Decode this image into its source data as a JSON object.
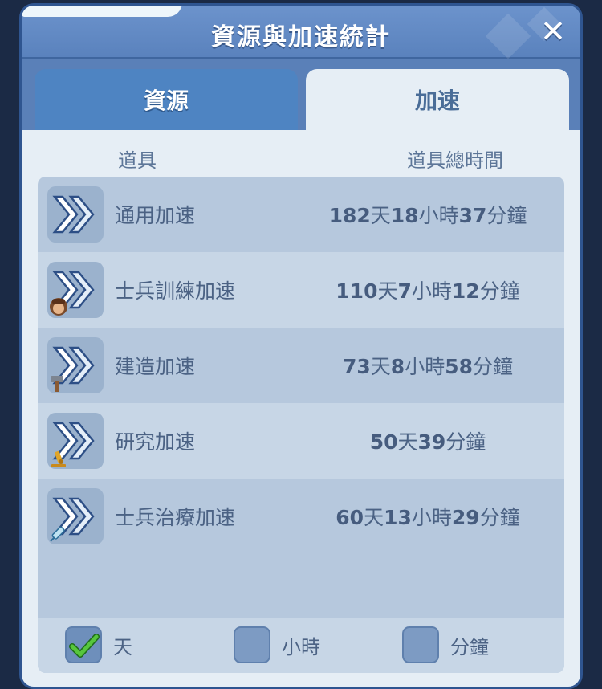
{
  "header": {
    "title": "資源與加速統計",
    "close_icon": "close-icon"
  },
  "tabs": [
    {
      "label": "資源",
      "active": false
    },
    {
      "label": "加速",
      "active": true
    }
  ],
  "columns": {
    "item": "道具",
    "total_time": "道具總時間"
  },
  "items": [
    {
      "name": "通用加速",
      "icon": "speedup-arrows-icon",
      "badge": "",
      "days": "182",
      "hours": "18",
      "minutes": "37"
    },
    {
      "name": "士兵訓練加速",
      "icon": "speedup-arrows-icon",
      "badge": "soldier-head-icon",
      "days": "110",
      "hours": "7",
      "minutes": "12"
    },
    {
      "name": "建造加速",
      "icon": "speedup-arrows-icon",
      "badge": "hammer-icon",
      "days": "73",
      "hours": "8",
      "minutes": "58"
    },
    {
      "name": "研究加速",
      "icon": "speedup-arrows-icon",
      "badge": "microscope-icon",
      "days": "50",
      "hours": "",
      "minutes": "39"
    },
    {
      "name": "士兵治療加速",
      "icon": "speedup-arrows-icon",
      "badge": "syringe-icon",
      "days": "60",
      "hours": "13",
      "minutes": "29"
    }
  ],
  "units": {
    "day": "天",
    "hour": "小時",
    "minute": "分鐘"
  },
  "footer": {
    "options": [
      {
        "label": "天",
        "checked": true
      },
      {
        "label": "小時",
        "checked": false
      },
      {
        "label": "分鐘",
        "checked": false
      }
    ]
  },
  "colors": {
    "panel": "#5a80b8",
    "active_tab": "#e6eef5",
    "inactive_tab": "#4e84c2",
    "text": "#4b6284",
    "check": "#3fae2e"
  }
}
